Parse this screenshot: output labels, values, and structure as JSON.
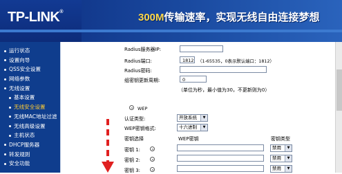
{
  "brand": {
    "logo": "TP-LINK",
    "trademark": "®"
  },
  "banner": {
    "slogan_hl": "300M",
    "slogan": "传输速率，实现无线自由连接梦想"
  },
  "sidebar": {
    "items": [
      {
        "label": "运行状态",
        "sub": false
      },
      {
        "label": "设置向导",
        "sub": false
      },
      {
        "label": "QSS安全设置",
        "sub": false
      },
      {
        "label": "网络参数",
        "sub": false
      },
      {
        "label": "无线设置",
        "sub": false
      },
      {
        "label": "基本设置",
        "sub": true
      },
      {
        "label": "无线安全设置",
        "sub": true,
        "active": true
      },
      {
        "label": "无线MAC地址过滤",
        "sub": true
      },
      {
        "label": "无线高级设置",
        "sub": true
      },
      {
        "label": "主机状态",
        "sub": true
      },
      {
        "label": "DHCP服务器",
        "sub": false
      },
      {
        "label": "转发规则",
        "sub": false
      },
      {
        "label": "安全功能",
        "sub": false
      }
    ]
  },
  "radius": {
    "ip_label": "Radius服务器IP:",
    "ip_value": "",
    "port_label": "Radius端口:",
    "port_value": "1812",
    "port_hint": "（1-65535，0表示默认端口：1812）",
    "password_label": "Radius密码:",
    "password_value": "",
    "renew_label": "组密钥更新周期:",
    "renew_value": "0",
    "renew_hint": "（单位为秒，最小值为30，不更新则为0）"
  },
  "wep": {
    "option_label": "WEP",
    "auth_label": "认证类型:",
    "auth_value": "开放系统",
    "format_label": "WEP密钥格式:",
    "format_value": "十六进制",
    "col_select": "密钥选择",
    "col_key": "WEP密钥",
    "col_type": "密钥类型",
    "keys": [
      {
        "label": "密钥 1:",
        "value": "",
        "type": "禁用"
      },
      {
        "label": "密钥 2:",
        "value": "",
        "type": "禁用"
      },
      {
        "label": "密钥 3:",
        "value": "",
        "type": "禁用"
      }
    ]
  },
  "colors": {
    "banner": "#0c2c7e",
    "sidebar": "#0f3d8d",
    "arrow": "#e02020",
    "active": "#ffcc33"
  }
}
